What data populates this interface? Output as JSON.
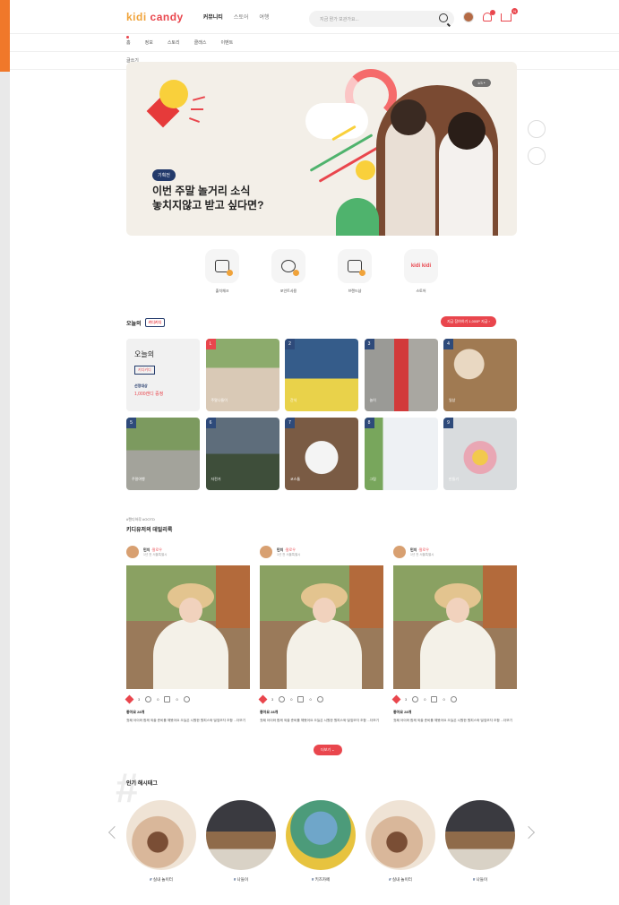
{
  "header": {
    "logo_a": "kidi",
    "logo_b": "candy",
    "nav": [
      "커뮤니티",
      "스토어",
      "여행"
    ],
    "search_placeholder": "지금 뭔가 보관가요...",
    "cart_badge": "N"
  },
  "subnav": {
    "items": [
      "홈",
      "정보",
      "스토리",
      "클래스",
      "이벤트"
    ],
    "more": "글쓰기"
  },
  "banner": {
    "tag": "기획전",
    "title_line1": "이번 주말 놀거리 소식",
    "title_line2": "놓치지않고 받고 싶다면?",
    "pager": "1/3 ‣"
  },
  "quick_menu": [
    {
      "icon": "calendar-check-icon",
      "label": "출석체크"
    },
    {
      "icon": "coin-point-icon",
      "label": "포인트사용"
    },
    {
      "icon": "shop-basket-icon",
      "label": "브랜드샵"
    },
    {
      "icon": "kidi-logo-icon",
      "label": "스토어",
      "mark": "kidi kidi"
    }
  ],
  "today": {
    "title": "오늘의",
    "tag": "키디키디",
    "pill": "지금 참여하기 1,000P 지급 ›",
    "intro": {
      "line1": "오늘의",
      "tag": "키디키디",
      "line3": "선정대상",
      "line4": "1,000캔디 증정"
    },
    "items": [
      {
        "rank": "L",
        "caption": "주말나들이"
      },
      {
        "rank": "2",
        "caption": "간식"
      },
      {
        "rank": "3",
        "caption": "놀이"
      },
      {
        "rank": "4",
        "caption": "일상"
      },
      {
        "rank": "5",
        "caption": "주말여행"
      },
      {
        "rank": "6",
        "caption": "자전거"
      },
      {
        "rank": "7",
        "caption": "코스튬"
      },
      {
        "rank": "8",
        "caption": "그림"
      },
      {
        "rank": "9",
        "caption": "만들기"
      }
    ]
  },
  "daily": {
    "small": "#캔디하루 #OOTD",
    "title": "키디유저의 데일리룩",
    "posts": [
      {
        "name": "민지",
        "tag": "·팔로우",
        "sub": "1년 전 서울특별시",
        "likes": "3",
        "comments": "0",
        "shares": "0",
        "date": "좋아요 28개",
        "text": "첫째 아이와 함께 외출 준비를 해봤어요 오늘은 시원한 원피스와 밀짚모자 조합 ...더보기"
      },
      {
        "name": "민지",
        "tag": "·팔로우",
        "sub": "1년 전 서울특별시",
        "likes": "3",
        "comments": "0",
        "shares": "0",
        "date": "좋아요 28개",
        "text": "첫째 아이와 함께 외출 준비를 해봤어요 오늘은 시원한 원피스와 밀짚모자 조합 ...더보기"
      },
      {
        "name": "민지",
        "tag": "·팔로우",
        "sub": "1년 전 서울특별시",
        "likes": "3",
        "comments": "0",
        "shares": "0",
        "date": "좋아요 28개",
        "text": "첫째 아이와 함께 외출 준비를 해봤어요 오늘은 시원한 원피스와 밀짚모자 조합 ...더보기"
      }
    ],
    "more": "더보기 ⌄"
  },
  "hashtags": {
    "title": "인기 해시태그",
    "items": [
      {
        "tag": "#",
        "label": "실내 놀이터"
      },
      {
        "tag": "#",
        "label": "나들이"
      },
      {
        "tag": "#",
        "label": "키즈카페"
      },
      {
        "tag": "#",
        "label": "실내 놀이터"
      },
      {
        "tag": "#",
        "label": "나들이"
      }
    ]
  },
  "colors": {
    "brand": "#e9464d",
    "navy": "#233a6b",
    "accent": "#f0782a"
  }
}
